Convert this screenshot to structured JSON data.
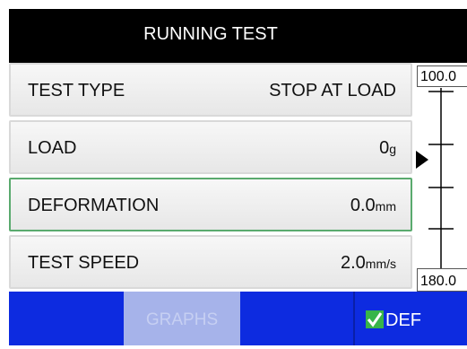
{
  "header": {
    "title": "RUNNING TEST"
  },
  "rows": [
    {
      "label": "TEST TYPE",
      "value": "STOP AT LOAD",
      "unit": ""
    },
    {
      "label": "LOAD",
      "value": "0",
      "unit": "g"
    },
    {
      "label": "DEFORMATION",
      "value": "0.0",
      "unit": "mm"
    },
    {
      "label": "TEST SPEED",
      "value": "2.0",
      "unit": "mm/s"
    }
  ],
  "scale": {
    "top_value": "100.0",
    "bottom_value": "180.0"
  },
  "footer": {
    "graphs_label": "GRAPHS",
    "def_label": "DEF"
  },
  "colors": {
    "footer": "#0d2be0",
    "graphs_button": "#a6b3ea",
    "selected_border": "#5aaa6e",
    "check": "#38b549"
  }
}
